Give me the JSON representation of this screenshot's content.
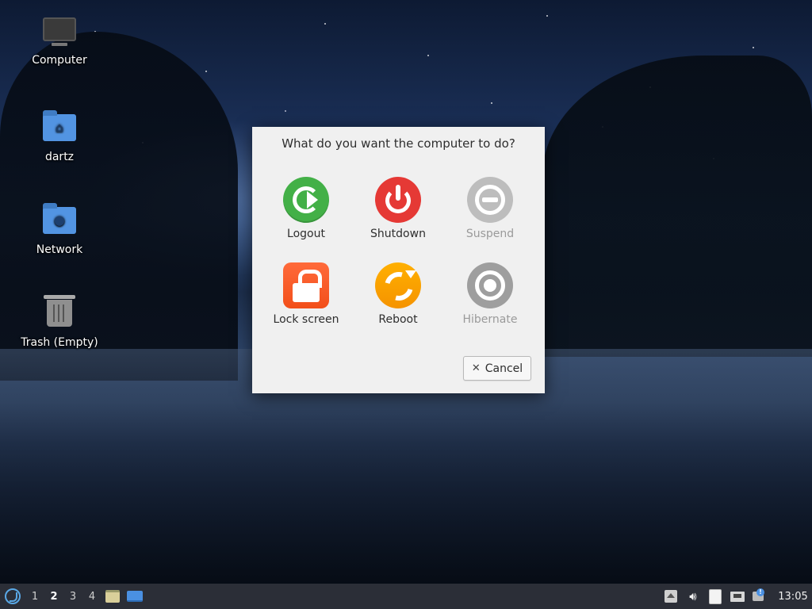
{
  "desktop": {
    "icons": [
      {
        "label": "Computer",
        "icon": "computer-icon"
      },
      {
        "label": "dartz",
        "icon": "home-folder-icon"
      },
      {
        "label": "Network",
        "icon": "network-folder-icon"
      },
      {
        "label": "Trash (Empty)",
        "icon": "trash-icon"
      }
    ]
  },
  "dialog": {
    "title": "What do you want the computer to do?",
    "actions": [
      {
        "label": "Logout",
        "icon": "logout-icon",
        "color": "#43b047",
        "enabled": true
      },
      {
        "label": "Shutdown",
        "icon": "power-icon",
        "color": "#e53935",
        "enabled": true
      },
      {
        "label": "Suspend",
        "icon": "suspend-icon",
        "color": "#bdbdbd",
        "enabled": false
      },
      {
        "label": "Lock screen",
        "icon": "lock-icon",
        "color": "#ff5722",
        "enabled": true
      },
      {
        "label": "Reboot",
        "icon": "reboot-icon",
        "color": "#ff9f00",
        "enabled": true
      },
      {
        "label": "Hibernate",
        "icon": "hibernate-icon",
        "color": "#9e9e9e",
        "enabled": false
      }
    ],
    "cancel_label": "Cancel"
  },
  "taskbar": {
    "workspaces": [
      "1",
      "2",
      "3",
      "4"
    ],
    "active_workspace": "2",
    "clock": "13:05"
  }
}
